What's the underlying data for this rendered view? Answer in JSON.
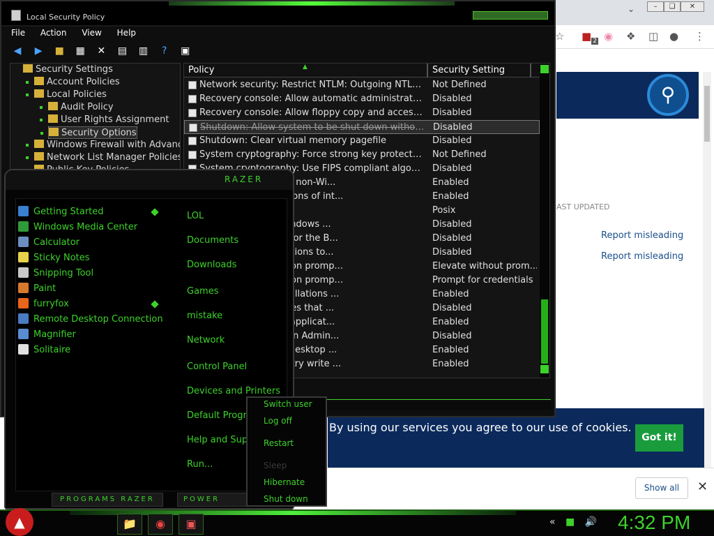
{
  "browser": {
    "window_buttons": [
      "–",
      "❏",
      "✕"
    ],
    "toolbar_icons": [
      "star-icon",
      "extension-badge-icon",
      "profile-flag-icon",
      "puzzle-icon",
      "sidepanel-icon",
      "account-icon",
      "menu-dots-icon"
    ],
    "badge_count": "2",
    "last_updated_label": "AST UPDATED",
    "report_links": [
      "Report misleading",
      "Report misleading"
    ],
    "cookie_text": "By using our services you agree to our use of cookies.",
    "cookie_button": "Got it!",
    "show_all": "Show all",
    "close": "✕"
  },
  "secpol": {
    "title": "Local Security Policy",
    "menu": [
      "File",
      "Action",
      "View",
      "Help"
    ],
    "tree": [
      {
        "label": "Security Settings",
        "level": 0
      },
      {
        "label": "Account Policies",
        "level": 1
      },
      {
        "label": "Local Policies",
        "level": 1
      },
      {
        "label": "Audit Policy",
        "level": 2
      },
      {
        "label": "User Rights Assignment",
        "level": 2
      },
      {
        "label": "Security Options",
        "level": 2,
        "selected": true
      },
      {
        "label": "Windows Firewall with Advanced S",
        "level": 1
      },
      {
        "label": "Network List Manager Policies",
        "level": 1
      },
      {
        "label": "Public Key Policies",
        "level": 1
      }
    ],
    "columns": [
      "Policy",
      "Security Setting"
    ],
    "rows": [
      {
        "policy": "Network security: Restrict NTLM: Outgoing NTLM traff...",
        "setting": "Not Defined"
      },
      {
        "policy": "Recovery console: Allow automatic administrative logon",
        "setting": "Disabled"
      },
      {
        "policy": "Recovery console: Allow floppy copy and access to al...",
        "setting": "Disabled"
      },
      {
        "policy": "Shutdown: Allow system to be shut down without havi",
        "setting": "Disabled",
        "selected": true
      },
      {
        "policy": "Shutdown: Clear virtual memory pagefile",
        "setting": "Disabled"
      },
      {
        "policy": "System cryptography: Force strong key protection for...",
        "setting": "Not Defined"
      },
      {
        "policy": "System cryptography: Use FIPS compliant algorithms...",
        "setting": "Disabled"
      },
      {
        "policy": "case insensitivity for non-Wi...",
        "setting": "Enabled"
      },
      {
        "policy": "hen default permissions of int...",
        "setting": "Enabled"
      },
      {
        "policy": "al subsystems",
        "setting": "Posix"
      },
      {
        "policy": "rtificate Rules on Windows ...",
        "setting": "Disabled"
      },
      {
        "policy": "min Approval Mode for the B...",
        "setting": "Disabled"
      },
      {
        "policy": "ow UIAccess applications to...",
        "setting": "Disabled"
      },
      {
        "policy": "havior of the elevation promp...",
        "setting": "Elevate without prom..."
      },
      {
        "policy": "havior of the elevation promp...",
        "setting": "Prompt for credentials"
      },
      {
        "policy": "tect application installations ...",
        "setting": "Enabled"
      },
      {
        "policy": "ly elevate executables that ...",
        "setting": "Disabled"
      },
      {
        "policy": "ly elevate UIAccess applicat...",
        "setting": "Enabled"
      },
      {
        "policy": "n all administrators in Admin...",
        "setting": "Disabled"
      },
      {
        "policy": "witch to the secure desktop ...",
        "setting": "Enabled"
      },
      {
        "policy": "tualize file and registry write ...",
        "setting": "Enabled"
      }
    ]
  },
  "startmenu": {
    "logo": "RAZER",
    "apps": [
      {
        "label": "Getting Started",
        "icon": "getting-started-icon",
        "color": "#3a7fd0",
        "pinned": true
      },
      {
        "label": "Windows Media Center",
        "icon": "media-center-icon",
        "color": "#2f9a3a"
      },
      {
        "label": "Calculator",
        "icon": "calculator-icon",
        "color": "#6b8fc0"
      },
      {
        "label": "Sticky Notes",
        "icon": "sticky-notes-icon",
        "color": "#e8d24a"
      },
      {
        "label": "Snipping Tool",
        "icon": "snipping-tool-icon",
        "color": "#c9c9c9"
      },
      {
        "label": "Paint",
        "icon": "paint-icon",
        "color": "#d87a2b"
      },
      {
        "label": "furryfox",
        "icon": "firefox-icon",
        "color": "#e8651a",
        "pinned": true
      },
      {
        "label": "Remote Desktop Connection",
        "icon": "remote-desktop-icon",
        "color": "#4a7cc2"
      },
      {
        "label": "Magnifier",
        "icon": "magnifier-icon",
        "color": "#5a8cd0"
      },
      {
        "label": "Solitaire",
        "icon": "solitaire-icon",
        "color": "#e0e0e0"
      }
    ],
    "places": [
      "LOL",
      "Documents",
      "Downloads",
      "Games",
      "mistake",
      "Network",
      "Control Panel",
      "Devices and Printers",
      "Default Progra",
      "Help and Supp",
      "Run..."
    ],
    "programs_label": "PROGRAMS RAZER",
    "power_label": "POWER"
  },
  "powermenu": {
    "items": [
      {
        "label": "Switch user",
        "disabled": false
      },
      {
        "label": "Log off",
        "disabled": false
      },
      {
        "label": "Restart",
        "disabled": false
      },
      {
        "label": "Sleep",
        "disabled": true
      },
      {
        "label": "Hibernate",
        "disabled": false
      },
      {
        "label": "Shut down",
        "disabled": false
      }
    ]
  },
  "taskbar": {
    "start_icon": "angry-bird-start-icon",
    "buttons": [
      {
        "icon": "explorer-icon",
        "glyph": "📁"
      },
      {
        "icon": "chrome-icon",
        "glyph": "◉"
      },
      {
        "icon": "security-policy-icon",
        "glyph": "▣"
      }
    ],
    "tray": [
      "«",
      "■",
      "🔊"
    ],
    "clock": "4:32 PM"
  }
}
